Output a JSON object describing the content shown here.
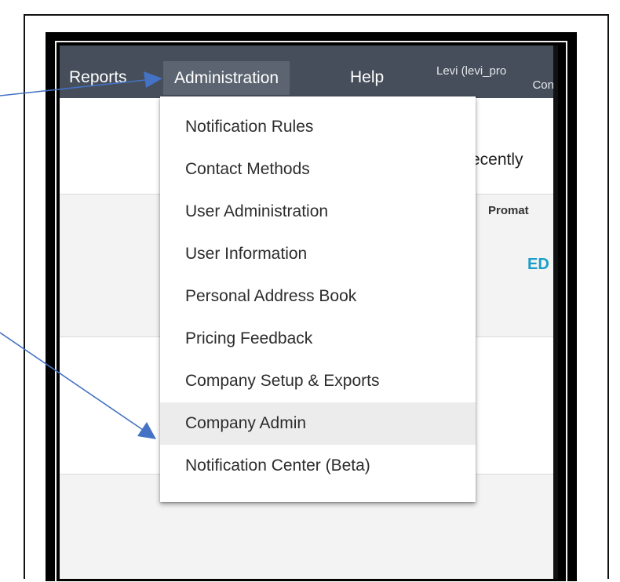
{
  "navbar": {
    "reports": "Reports",
    "administration": "Administration",
    "help": "Help",
    "user_line1": "Levi (levi_pro",
    "user_line2": "Con"
  },
  "content": {
    "recently": "ecently",
    "promat": "Promat",
    "ed": "ED"
  },
  "dropdown": {
    "items": [
      {
        "label": "Notification Rules"
      },
      {
        "label": "Contact Methods"
      },
      {
        "label": "User Administration"
      },
      {
        "label": "User Information"
      },
      {
        "label": "Personal Address Book"
      },
      {
        "label": "Pricing Feedback"
      },
      {
        "label": "Company Setup & Exports"
      },
      {
        "label": "Company Admin"
      },
      {
        "label": "Notification Center (Beta)"
      }
    ],
    "highlighted_index": 7
  },
  "colors": {
    "navbar": "#454e5a",
    "nav_active": "#5b6470",
    "arrow": "#4472c4",
    "link_accent": "#1a9ec7",
    "menu_hover": "#ececec"
  },
  "icons": {
    "annotation_arrow": "arrow-right-icon"
  }
}
